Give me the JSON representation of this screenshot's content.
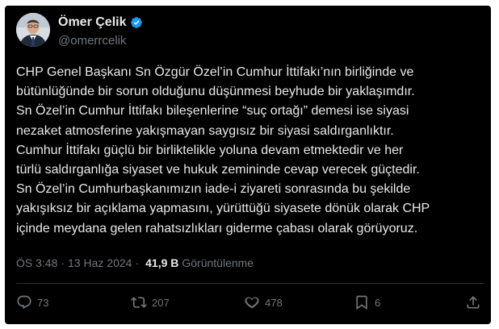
{
  "author": {
    "display_name": "Ömer Çelik",
    "handle": "@omerrcelik",
    "verified_color": "#1d9bf0"
  },
  "tweet": {
    "lines": [
      "CHP Genel Başkanı Sn Özgür Özel’in Cumhur İttifakı’nın birliğinde ve",
      "bütünlüğünde bir sorun olduğunu düşünmesi beyhude bir yaklaşımdır.",
      "Sn Özel’in Cumhur İttifakı bileşenlerine “suç ortağı” demesi ise siyasi",
      "nezaket atmosferine yakışmayan saygısız bir siyasi saldırganlıktır.",
      "Cumhur İttifakı güçlü bir birliktelikle yoluna devam etmektedir ve her",
      "türlü saldırganlığa siyaset ve hukuk zemininde cevap verecek güçtedir.",
      "Sn Özel’in Cumhurbaşkanımızın iade-i ziyareti sonrasında bu şekilde",
      "yakışıksız bir açıklama yapmasını, yürüttüğü siyasete dönük olarak CHP",
      "içinde meydana gelen rahatsızlıkları giderme çabası olarak görüyoruz."
    ]
  },
  "meta": {
    "time": "ÖS 3:48",
    "separator": "·",
    "date": "13 Haz 2024",
    "views_count": "41,9 B",
    "views_label": "Görüntülenme"
  },
  "actions": {
    "replies": "73",
    "reposts": "207",
    "likes": "478",
    "bookmarks": "6"
  },
  "icons": [
    "verified-badge-icon",
    "reply-icon",
    "repost-icon",
    "like-icon",
    "bookmark-icon",
    "share-icon"
  ]
}
